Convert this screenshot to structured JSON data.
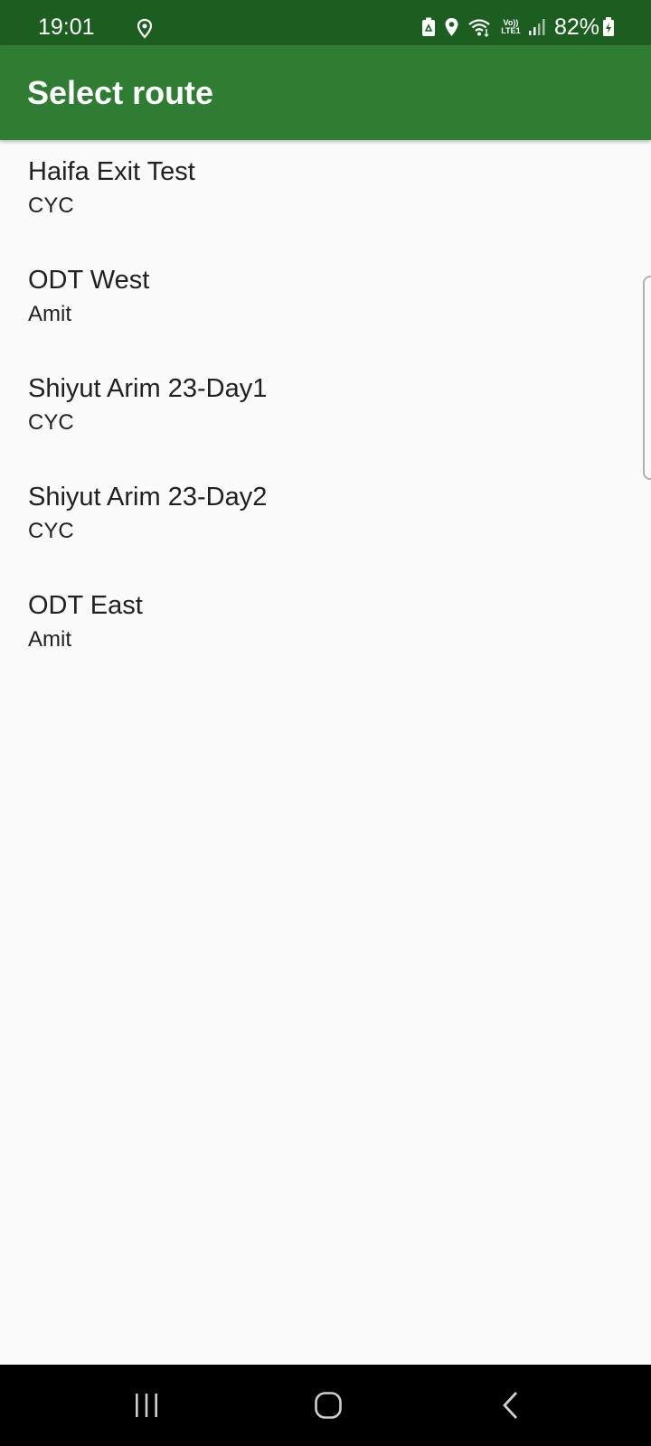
{
  "status_bar": {
    "time": "19:01",
    "battery_percent": "82%",
    "network_label": "Vo)) LTE1",
    "icons": [
      "location-icon",
      "recycle-icon",
      "location-pin-icon",
      "wifi-icon",
      "volte-icon",
      "signal-icon",
      "battery-charging-icon"
    ],
    "background_color": "#1b5e20"
  },
  "app_bar": {
    "title": "Select route",
    "background_color": "#2e7d32"
  },
  "routes": [
    {
      "name": "Haifa Exit Test",
      "owner": "CYC"
    },
    {
      "name": "ODT West",
      "owner": "Amit"
    },
    {
      "name": "Shiyut Arim 23-Day1",
      "owner": "CYC"
    },
    {
      "name": "Shiyut Arim 23-Day2",
      "owner": "CYC"
    },
    {
      "name": "ODT East",
      "owner": "Amit"
    }
  ],
  "nav_bar": {
    "buttons": [
      "recent-apps-icon",
      "home-icon",
      "back-icon"
    ]
  }
}
